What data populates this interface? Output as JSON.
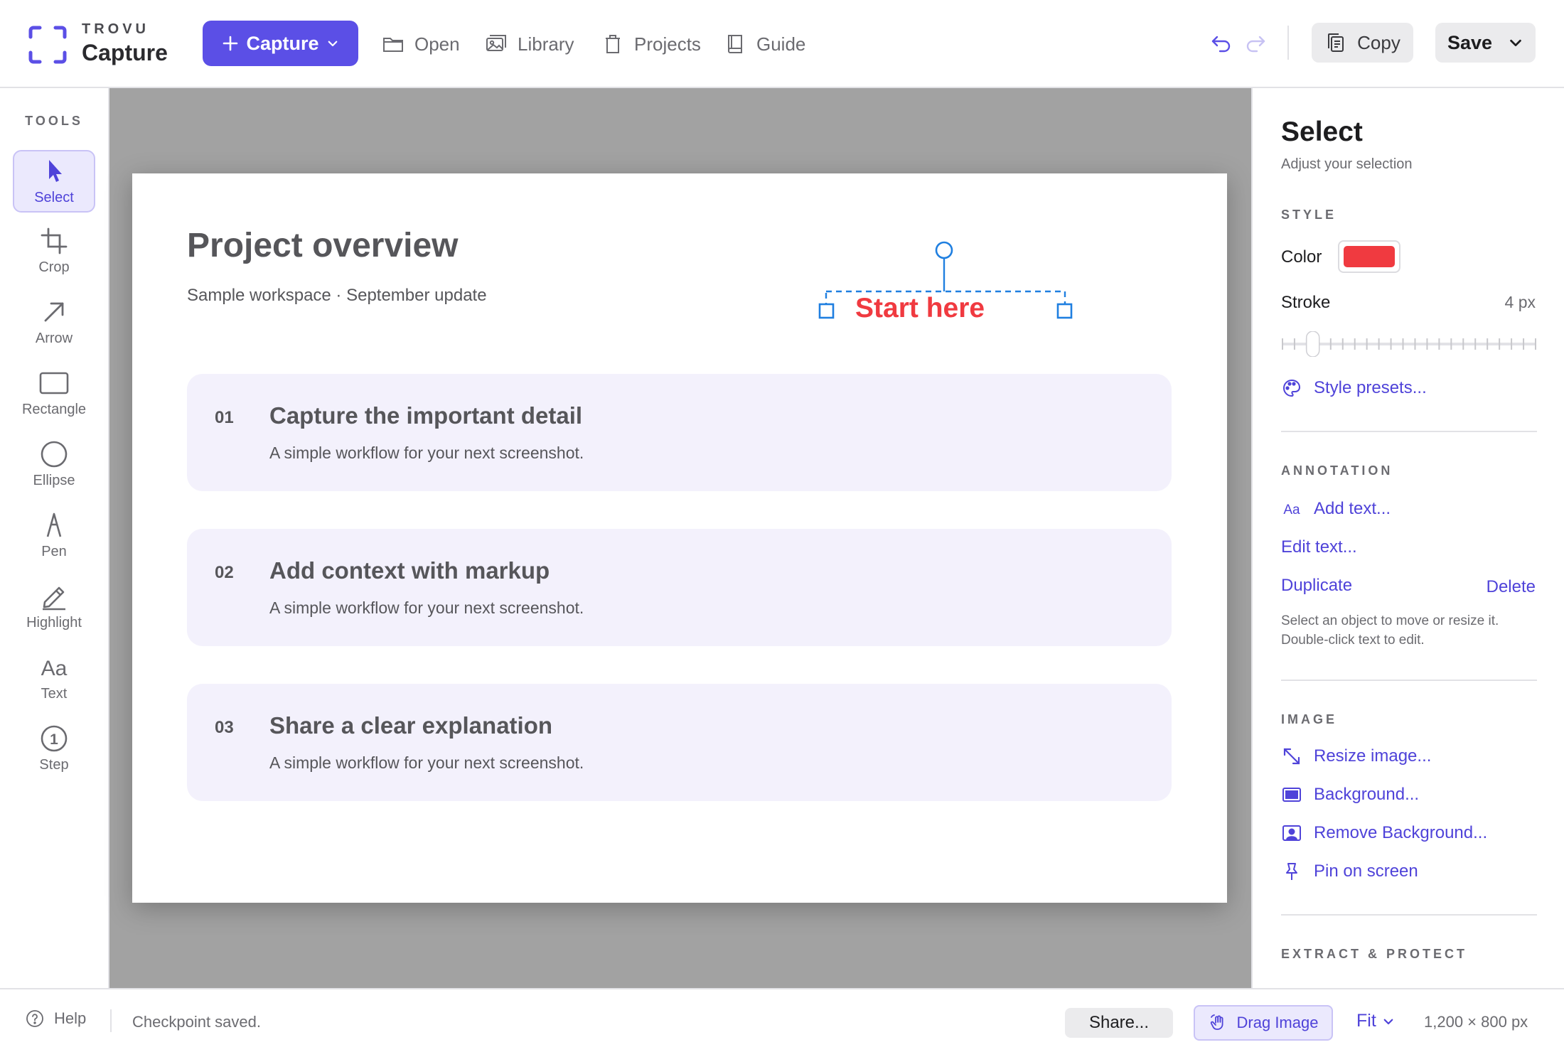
{
  "app": {
    "brand_small": "TROVU",
    "brand_name": "Capture",
    "accent": "#5b4fe6"
  },
  "toolbar": {
    "capture_label": "Capture",
    "nav": [
      {
        "label": "Open",
        "icon": "folder-icon"
      },
      {
        "label": "Library",
        "icon": "images-icon"
      },
      {
        "label": "Projects",
        "icon": "trash-can-icon"
      },
      {
        "label": "Guide",
        "icon": "book-icon"
      }
    ],
    "copy_label": "Copy",
    "save_label": "Save"
  },
  "tools": {
    "title": "TOOLS",
    "items": [
      {
        "label": "Select",
        "icon": "cursor-arrow-icon",
        "active": true
      },
      {
        "label": "Crop",
        "icon": "crop-icon",
        "active": false
      },
      {
        "label": "Arrow",
        "icon": "arrow-icon",
        "active": false
      },
      {
        "label": "Rectangle",
        "icon": "rectangle-icon",
        "active": false
      },
      {
        "label": "Ellipse",
        "icon": "ellipse-icon",
        "active": false
      },
      {
        "label": "Pen",
        "icon": "pen-icon",
        "active": false
      },
      {
        "label": "Highlight",
        "icon": "highlighter-icon",
        "active": false
      },
      {
        "label": "Text",
        "icon": "text-icon",
        "active": false
      },
      {
        "label": "Step",
        "icon": "step-number-icon",
        "active": false
      }
    ]
  },
  "document": {
    "title": "Project overview",
    "subtitle": "Sample workspace · September update",
    "annotation_text": "Start here",
    "annotation_color": "#f03a40",
    "cards": [
      {
        "num": "01",
        "title": "Capture the important detail",
        "desc": "A simple workflow for your next screenshot."
      },
      {
        "num": "02",
        "title": "Add context with markup",
        "desc": "A simple workflow for your next screenshot."
      },
      {
        "num": "03",
        "title": "Share a clear explanation",
        "desc": "A simple workflow for your next screenshot."
      }
    ]
  },
  "panel": {
    "title": "Select",
    "subtitle": "Adjust your selection",
    "style_section": "STYLE",
    "color_label": "Color",
    "color_value": "#f03a40",
    "stroke_label": "Stroke",
    "stroke_value": "4 px",
    "stroke_level": 0.12,
    "style_presets": "Style presets...",
    "annotation_section": "ANNOTATION",
    "add_text": "Add text...",
    "edit_text": "Edit text...",
    "duplicate": "Duplicate",
    "delete": "Delete",
    "help_line1": "Select an object to move or resize it.",
    "help_line2": "Double-click text to edit.",
    "image_section": "IMAGE",
    "resize_image": "Resize image...",
    "background": "Background...",
    "remove_background": "Remove Background...",
    "pin_on_screen": "Pin on screen",
    "extract_section": "EXTRACT & PROTECT"
  },
  "status": {
    "help": "Help",
    "message": "Checkpoint saved.",
    "share": "Share...",
    "drag_image": "Drag Image",
    "zoom": "Fit",
    "dimensions": "1,200 × 800 px"
  }
}
